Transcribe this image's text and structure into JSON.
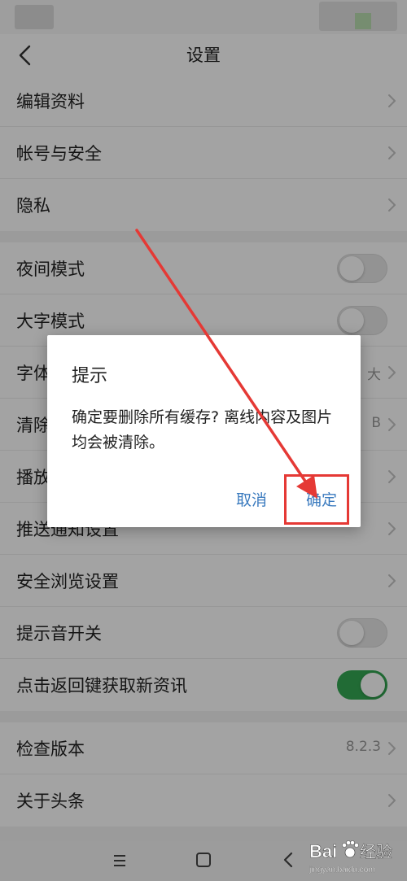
{
  "header": {
    "title": "设置",
    "back_icon": "chevron-left-icon"
  },
  "settings": {
    "groups": [
      [
        {
          "label": "编辑资料",
          "type": "link"
        },
        {
          "label": "帐号与安全",
          "type": "link"
        },
        {
          "label": "隐私",
          "type": "link"
        }
      ],
      [
        {
          "label": "夜间模式",
          "type": "toggle",
          "on": false
        },
        {
          "label": "大字模式",
          "type": "toggle",
          "on": false
        },
        {
          "label": "字体",
          "type": "value",
          "value": "大"
        },
        {
          "label": "清除",
          "type": "value",
          "value": "B"
        },
        {
          "label": "播放",
          "type": "link"
        },
        {
          "label": "推送通知设置",
          "type": "link"
        },
        {
          "label": "安全浏览设置",
          "type": "link"
        },
        {
          "label": "提示音开关",
          "type": "toggle",
          "on": false
        },
        {
          "label": "点击返回键获取新资讯",
          "type": "toggle",
          "on": true
        }
      ],
      [
        {
          "label": "检查版本",
          "type": "value",
          "value": "8.2.3"
        },
        {
          "label": "关于头条",
          "type": "link"
        }
      ]
    ]
  },
  "dialog": {
    "title": "提示",
    "message": "确定要删除所有缓存? 离线内容及图片均会被清除。",
    "cancel_label": "取消",
    "confirm_label": "确定"
  },
  "watermark": {
    "text_en": "Bai",
    "text_cn": "经验",
    "sub": "jingyan.baidu.com"
  },
  "colors": {
    "accent": "#3b7bbf",
    "toggle_on": "#34a853",
    "annotation": "#e53935"
  }
}
